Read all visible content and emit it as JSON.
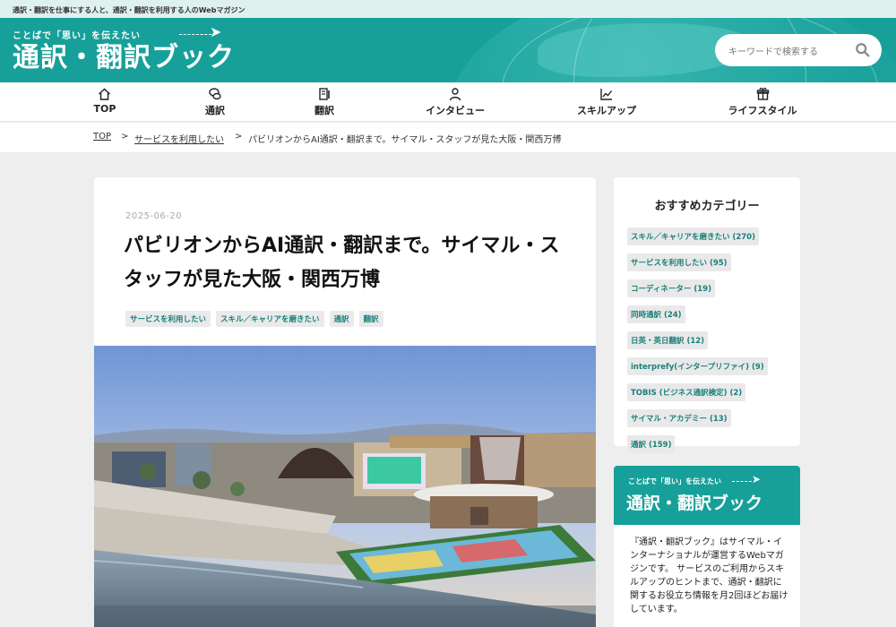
{
  "topstrip": {
    "text": "通訳・翻訳を仕事にする人と、通訳・翻訳を利用する人のWebマガジン"
  },
  "header": {
    "tagline": "ことばで「思い」を伝えたい",
    "logo": "通訳・翻訳ブック",
    "search_placeholder": "キーワードで検索する"
  },
  "nav": {
    "items": [
      {
        "label": "TOP",
        "icon": "home-icon"
      },
      {
        "label": "通訳",
        "icon": "speech-bubbles-icon"
      },
      {
        "label": "翻訳",
        "icon": "document-pen-icon"
      },
      {
        "label": "インタビュー",
        "icon": "person-icon"
      },
      {
        "label": "スキルアップ",
        "icon": "chart-up-icon"
      },
      {
        "label": "ライフスタイル",
        "icon": "gift-icon"
      }
    ]
  },
  "breadcrumb": {
    "top": "TOP",
    "sep1": ">",
    "category": "サービスを利用したい",
    "sep2": ">",
    "current": "パビリオンからAI通訳・翻訳まで。サイマル・スタッフが見た大阪・関西万博"
  },
  "article": {
    "date": "2025-06-20",
    "title": "パビリオンからAI通訳・翻訳まで。サイマル・スタッフが見た大阪・関西万博",
    "tags": [
      "サービスを利用したい",
      "スキル／キャリアを磨きたい",
      "通訳",
      "翻訳"
    ]
  },
  "sidebar": {
    "title": "おすすめカテゴリー",
    "categories": [
      "スキル／キャリアを磨きたい (270)",
      "サービスを利用したい (95)",
      "コーディネーター (19)",
      "同時通訳 (24)",
      "日英・英日翻訳 (12)",
      "interprefy(インタープリファイ) (9)",
      "TOBIS (ビジネス通訳検定) (2)",
      "サイマル・アカデミー (13)",
      "通訳 (159)"
    ],
    "promo": {
      "tagline": "ことばで「思い」を伝えたい",
      "logo": "通訳・翻訳ブック",
      "description": "『通訳・翻訳ブック』はサイマル・インターナショナルが運営するWebマガジンです。 サービスのご利用からスキルアップのヒントまで、通訳・翻訳に関するお役立ち情報を月2回ほどお届けしています。"
    }
  },
  "colors": {
    "teal": "#17a09a",
    "tag_text": "#187f7a"
  }
}
